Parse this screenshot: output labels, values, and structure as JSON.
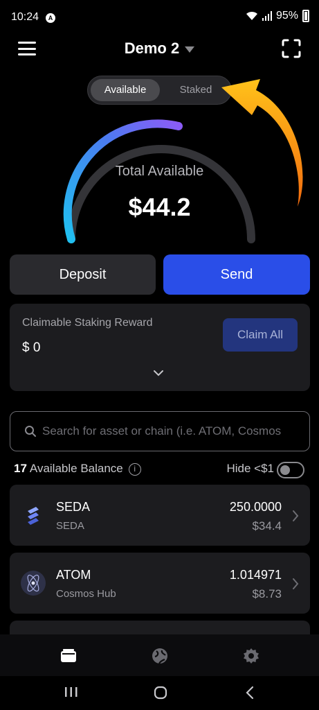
{
  "status_bar": {
    "time": "10:24",
    "battery": "95%"
  },
  "header": {
    "wallet_name": "Demo 2"
  },
  "tabs": {
    "available": "Available",
    "staked": "Staked",
    "active": "available"
  },
  "summary": {
    "label": "Total Available",
    "value": "$44.2"
  },
  "actions": {
    "deposit": "Deposit",
    "send": "Send"
  },
  "staking": {
    "title": "Claimable Staking Reward",
    "amount": "$ 0",
    "claim_label": "Claim All"
  },
  "search": {
    "placeholder": "Search for asset or chain (i.e. ATOM, Cosmos"
  },
  "balance": {
    "count": "17",
    "label": "Available Balance",
    "hide_label": "Hide <$1",
    "hide_small": false
  },
  "assets": [
    {
      "symbol": "SEDA",
      "chain": "SEDA",
      "amount": "250.0000",
      "usd": "$34.4",
      "icon": "seda-logo"
    },
    {
      "symbol": "ATOM",
      "chain": "Cosmos Hub",
      "amount": "1.014971",
      "usd": "$8.73",
      "icon": "cosmos-logo"
    }
  ],
  "colors": {
    "accent": "#2a4ee8",
    "gauge_start": "#26b5f2",
    "gauge_end": "#8b5cf6"
  }
}
